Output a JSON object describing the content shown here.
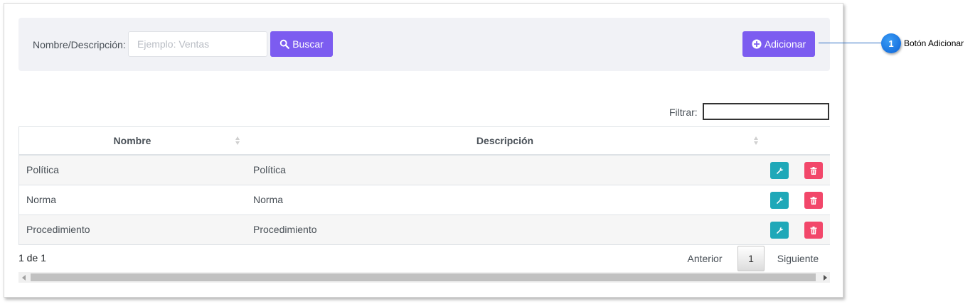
{
  "search": {
    "label": "Nombre/Descripción:",
    "placeholder": "Ejemplo: Ventas",
    "value": "",
    "search_button": "Buscar",
    "add_button": "Adicionar"
  },
  "filter": {
    "label": "Filtrar:",
    "value": ""
  },
  "table": {
    "columns": [
      "Nombre",
      "Descripción"
    ],
    "rows": [
      {
        "name": "Política",
        "description": "Política"
      },
      {
        "name": "Norma",
        "description": "Norma"
      },
      {
        "name": "Procedimiento",
        "description": "Procedimiento"
      }
    ]
  },
  "pagination": {
    "info": "1 de 1",
    "prev": "Anterior",
    "current": "1",
    "next": "Siguiente"
  },
  "callout": {
    "number": "1",
    "text": "Botón Adicionar"
  },
  "colors": {
    "primary": "#7c5cf0",
    "edit": "#1fa8b8",
    "delete": "#f2476a",
    "callout": "#0b62d6"
  },
  "icons": {
    "search_button": "search-icon",
    "add_button": "plus-circle-icon",
    "edit": "wrench-icon",
    "delete": "trash-icon"
  }
}
